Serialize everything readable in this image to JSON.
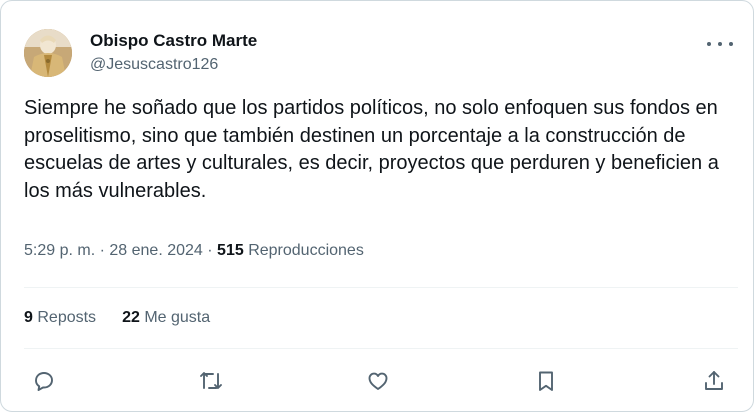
{
  "author": {
    "display_name": "Obispo Castro Marte",
    "handle": "@Jesuscastro126"
  },
  "tweet": {
    "text": "Siempre he soñado que los partidos políticos, no solo enfoquen sus fondos en proselitismo, sino que también destinen un porcentaje a la construcción de escuelas de artes y culturales, es decir, proyectos que perduren y beneficien a los más vulnerables.",
    "time": "5:29 p. m.",
    "separator": "·",
    "date": "28 ene. 2024",
    "views_count": "515",
    "views_label": "Reproducciones"
  },
  "stats": {
    "reposts_count": "9",
    "reposts_label": "Reposts",
    "likes_count": "22",
    "likes_label": "Me gusta"
  },
  "icons": {
    "reply": "reply-icon",
    "repost": "repost-icon",
    "like": "heart-icon",
    "bookmark": "bookmark-icon",
    "share": "share-icon",
    "more": "more-icon"
  },
  "colors": {
    "text": "#0f1419",
    "secondary": "#536471",
    "border": "#cfd9de"
  }
}
